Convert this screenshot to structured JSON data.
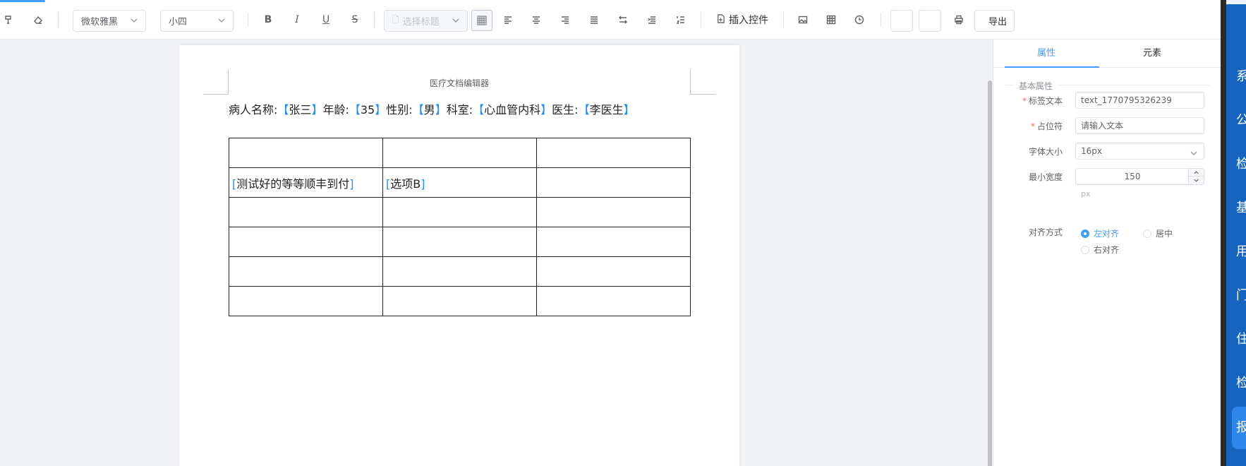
{
  "toolbar": {
    "font_family": "微软雅黑",
    "font_size": "小四",
    "bold": "B",
    "italic": "I",
    "underline": "U",
    "strike": "S",
    "heading_placeholder": "选择标题",
    "insert_control": "插入控件",
    "export": "导出"
  },
  "document": {
    "header": "医疗文档编辑器",
    "patient_line": [
      {
        "label": "病人名称:",
        "value": "张三"
      },
      {
        "label": "年龄:",
        "value": "35"
      },
      {
        "label": "性别:",
        "value": "男"
      },
      {
        "label": "科室:",
        "value": "心血管内科"
      },
      {
        "label": "医生:",
        "value": "李医生"
      }
    ],
    "table": {
      "rows": [
        [
          "",
          "",
          ""
        ],
        [
          "测试好的等等顺丰到付",
          "选项B",
          ""
        ],
        [
          "",
          "",
          ""
        ],
        [
          "",
          "",
          ""
        ],
        [
          "",
          "",
          ""
        ],
        [
          "",
          "",
          ""
        ]
      ]
    }
  },
  "panel": {
    "tabs": [
      "属性",
      "元素"
    ],
    "active_tab": 0,
    "section": "基本属性",
    "fields": {
      "label_text": {
        "label": "标签文本",
        "value": "text_1770795326239"
      },
      "placeholder": {
        "label": "占位符",
        "value": "请输入文本"
      },
      "font_size": {
        "label": "字体大小",
        "value": "16px"
      },
      "min_width": {
        "label": "最小宽度",
        "value": "150",
        "unit": "px"
      },
      "align": {
        "label": "对齐方式",
        "options": [
          "左对齐",
          "居中",
          "右对齐"
        ],
        "selected": 0
      }
    }
  },
  "side_nav": {
    "items": [
      "系",
      "公",
      "检",
      "基",
      "用",
      "门",
      "住",
      "检",
      "报"
    ],
    "active": 8
  },
  "colors": {
    "accent": "#409eff",
    "bracket": "#1890ff",
    "side_nav": "#1565c0"
  }
}
